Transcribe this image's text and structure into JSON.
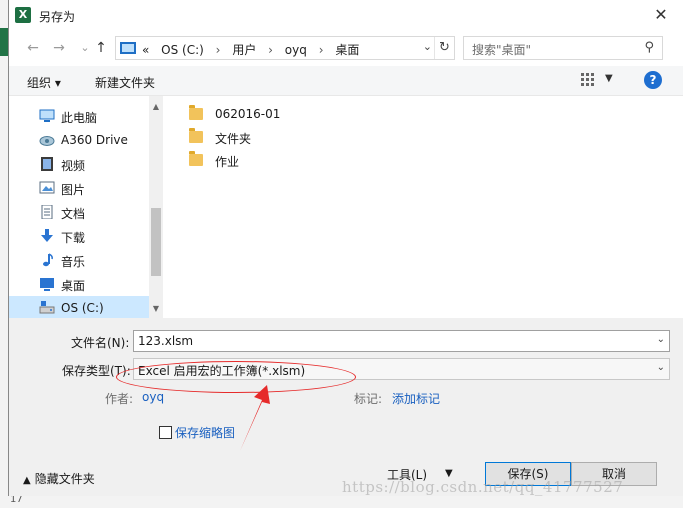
{
  "window": {
    "title": "另存为"
  },
  "nav": {
    "back": "←",
    "forward": "→",
    "up": "↑"
  },
  "address": {
    "overflow": "«",
    "crumbs": [
      "OS (C:)",
      "用户",
      "oyq",
      "桌面"
    ],
    "separator": "›"
  },
  "search": {
    "placeholder": "搜索\"桌面\""
  },
  "toolbar": {
    "organize": "组织 ▾",
    "new_folder": "新建文件夹",
    "help": "?"
  },
  "sidebar": {
    "items": [
      {
        "label": "此电脑",
        "icon": "computer-icon"
      },
      {
        "label": "A360 Drive",
        "icon": "cloud-drive-icon"
      },
      {
        "label": "视频",
        "icon": "video-icon"
      },
      {
        "label": "图片",
        "icon": "picture-icon"
      },
      {
        "label": "文档",
        "icon": "document-icon"
      },
      {
        "label": "下载",
        "icon": "download-icon"
      },
      {
        "label": "音乐",
        "icon": "music-icon"
      },
      {
        "label": "桌面",
        "icon": "desktop-icon"
      },
      {
        "label": "OS (C:)",
        "icon": "drive-icon",
        "selected": true
      }
    ]
  },
  "files": {
    "items": [
      {
        "name": "062016-01",
        "icon": "folder-icon"
      },
      {
        "name": "文件夹",
        "icon": "folder-icon"
      },
      {
        "name": "作业",
        "icon": "folder-icon"
      }
    ]
  },
  "form": {
    "filename_label": "文件名(N):",
    "filename_value": "123.xlsm",
    "filetype_label": "保存类型(T):",
    "filetype_value": "Excel 启用宏的工作簿(*.xlsm)",
    "author_label": "作者:",
    "author_value": "oyq",
    "tags_label": "标记:",
    "tags_value": "添加标记",
    "thumbnail_label": "保存缩略图"
  },
  "footer": {
    "hide_folders": "隐藏文件夹",
    "tools": "工具(L)",
    "save": "保存(S)",
    "cancel": "取消"
  },
  "background": {
    "row_number": "17"
  },
  "watermark": "https://blog.csdn.net/qq_41777527",
  "colors": {
    "selection": "#cce8ff",
    "link": "#1a60c0",
    "annotation": "#e62b2b",
    "excel_green": "#217346"
  }
}
